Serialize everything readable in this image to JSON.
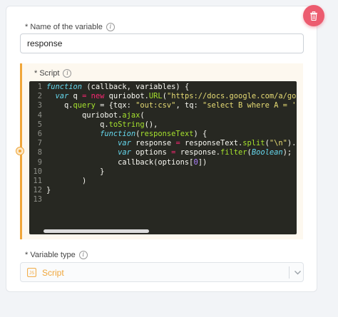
{
  "variable": {
    "name_label": "* Name of the variable",
    "name_value": "response",
    "script_label": "* Script",
    "type_label": "* Variable type",
    "type_value": "Script"
  },
  "icons": {
    "delete": "trash-icon",
    "info": "info-icon",
    "type": "script-file-icon",
    "dropdown": "chevron-down-icon"
  },
  "colors": {
    "delete_button": "#ec5b6f",
    "accent": "#f0a63a",
    "editor_bg": "#272822"
  },
  "code_lines": [
    {
      "n": "1",
      "tokens": [
        [
          "kw",
          "function "
        ],
        [
          "plain",
          "(callback, variables) {"
        ]
      ]
    },
    {
      "n": "2",
      "tokens": [
        [
          "plain",
          "  "
        ],
        [
          "kw",
          "var "
        ],
        [
          "plain",
          "q "
        ],
        [
          "op",
          "= new "
        ],
        [
          "plain",
          "quriobot."
        ],
        [
          "fn",
          "URL"
        ],
        [
          "plain",
          "("
        ],
        [
          "str",
          "\"https://docs.google.com/a/goog"
        ]
      ]
    },
    {
      "n": "3",
      "tokens": [
        [
          "plain",
          "    q."
        ],
        [
          "fn",
          "query"
        ],
        [
          "plain",
          " = {tqx: "
        ],
        [
          "str",
          "\"out:csv\""
        ],
        [
          "plain",
          ", tq: "
        ],
        [
          "str",
          "\"select B where A = '\""
        ]
      ]
    },
    {
      "n": "4",
      "tokens": [
        [
          "plain",
          "        quriobot."
        ],
        [
          "fn",
          "ajax"
        ],
        [
          "plain",
          "("
        ]
      ]
    },
    {
      "n": "5",
      "tokens": [
        [
          "plain",
          "            q."
        ],
        [
          "fn",
          "toString"
        ],
        [
          "plain",
          "(),"
        ]
      ]
    },
    {
      "n": "6",
      "tokens": [
        [
          "plain",
          "            "
        ],
        [
          "kw",
          "function"
        ],
        [
          "plain",
          "("
        ],
        [
          "fn",
          "responseText"
        ],
        [
          "plain",
          ") {"
        ]
      ]
    },
    {
      "n": "7",
      "tokens": [
        [
          "plain",
          "                "
        ],
        [
          "kw",
          "var "
        ],
        [
          "plain",
          "response "
        ],
        [
          "op",
          "= "
        ],
        [
          "plain",
          "responseText."
        ],
        [
          "fn",
          "split"
        ],
        [
          "plain",
          "("
        ],
        [
          "str",
          "\"\\n\""
        ],
        [
          "plain",
          ").fi"
        ]
      ]
    },
    {
      "n": "8",
      "tokens": [
        [
          "plain",
          "                "
        ],
        [
          "kw",
          "var "
        ],
        [
          "plain",
          "options "
        ],
        [
          "op",
          "= "
        ],
        [
          "plain",
          "response."
        ],
        [
          "fn",
          "filter"
        ],
        [
          "plain",
          "("
        ],
        [
          "cls",
          "Boolean"
        ],
        [
          "plain",
          ");"
        ]
      ]
    },
    {
      "n": "9",
      "tokens": [
        [
          "plain",
          "                callback(options["
        ],
        [
          "num",
          "0"
        ],
        [
          "plain",
          "])"
        ]
      ]
    },
    {
      "n": "10",
      "tokens": [
        [
          "plain",
          "            }"
        ]
      ]
    },
    {
      "n": "11",
      "tokens": [
        [
          "plain",
          "        )"
        ]
      ]
    },
    {
      "n": "12",
      "tokens": [
        [
          "plain",
          "}"
        ]
      ]
    },
    {
      "n": "13",
      "tokens": []
    }
  ]
}
